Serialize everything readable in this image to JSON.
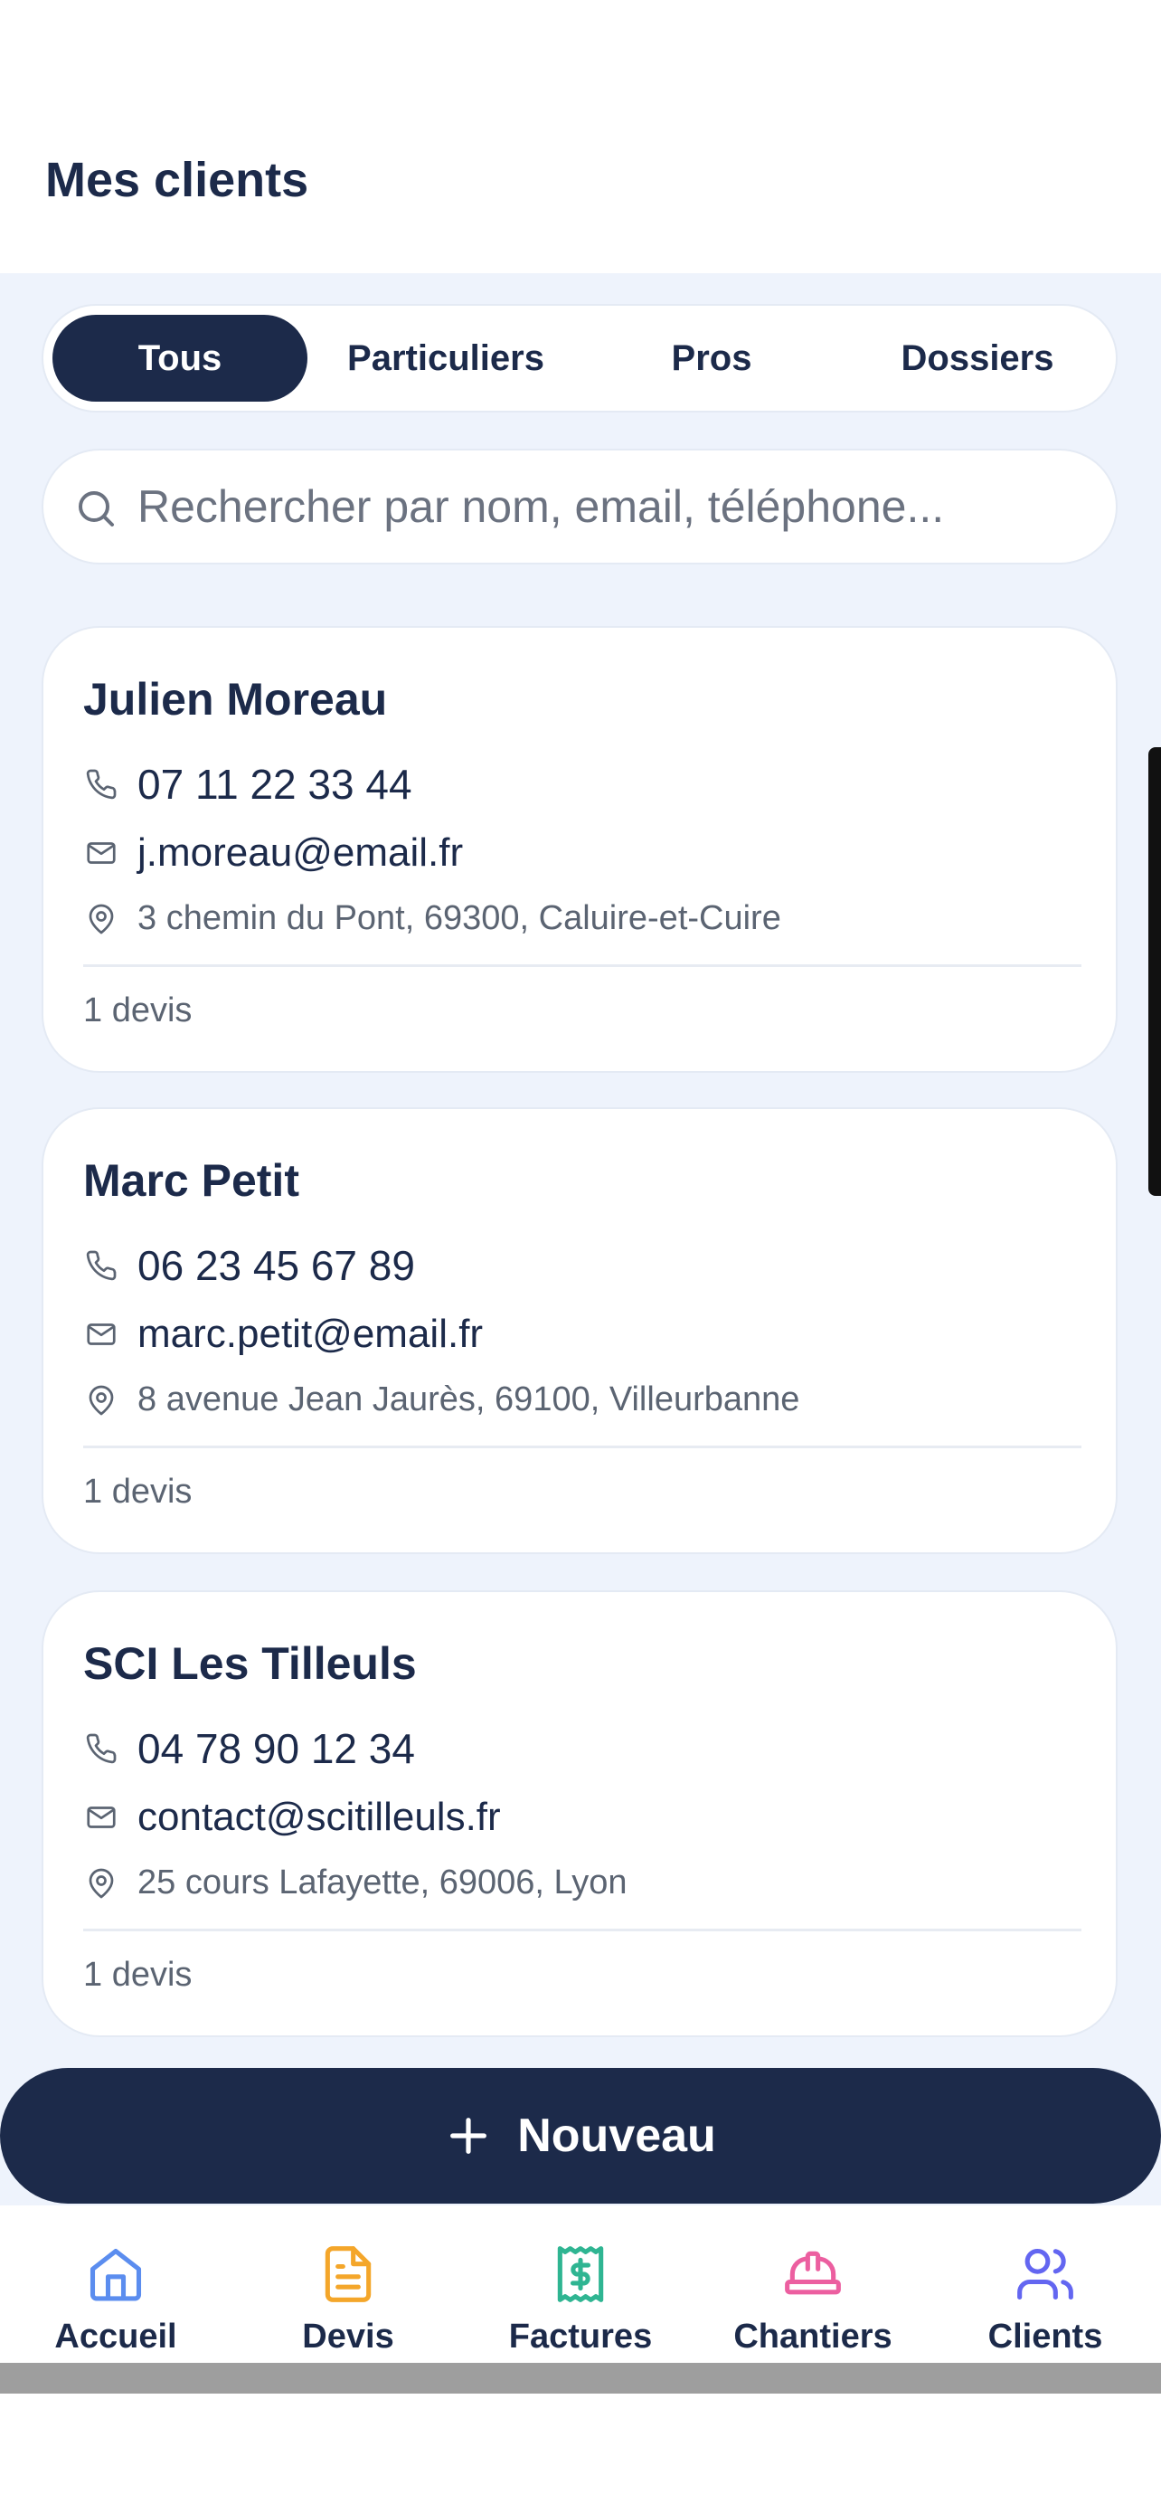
{
  "header": {
    "title": "Mes clients"
  },
  "tabs": [
    {
      "label": "Tous",
      "active": true
    },
    {
      "label": "Particuliers",
      "active": false
    },
    {
      "label": "Pros",
      "active": false
    },
    {
      "label": "Dossiers",
      "active": false
    }
  ],
  "search": {
    "placeholder": "Rechercher par nom, email, téléphone...",
    "value": "",
    "icon": "search-icon"
  },
  "clients": [
    {
      "name": "Julien Moreau",
      "phone": "07 11 22 33 44",
      "email": "j.moreau@email.fr",
      "address": "3 chemin du Pont, 69300, Caluire-et-Cuire",
      "devis": "1 devis"
    },
    {
      "name": "Marc Petit",
      "phone": "06 23 45 67 89",
      "email": "marc.petit@email.fr",
      "address": "8 avenue Jean Jaurès, 69100, Villeurbanne",
      "devis": "1 devis"
    },
    {
      "name": "SCI Les Tilleuls",
      "phone": "04 78 90 12 34",
      "email": "contact@scitilleuls.fr",
      "address": "25 cours Lafayette, 69006, Lyon",
      "devis": "1 devis"
    }
  ],
  "fab": {
    "label": "Nouveau",
    "icon": "plus-icon"
  },
  "nav": [
    {
      "label": "Accueil",
      "icon": "home-icon",
      "color": "#5b8def"
    },
    {
      "label": "Devis",
      "icon": "document-icon",
      "color": "#f4a62a"
    },
    {
      "label": "Factures",
      "icon": "receipt-icon",
      "color": "#2fb592"
    },
    {
      "label": "Chantiers",
      "icon": "hardhat-icon",
      "color": "#ec5fa0"
    },
    {
      "label": "Clients",
      "icon": "users-icon",
      "color": "#6366f1"
    }
  ],
  "colors": {
    "primary": "#1c2a4a",
    "background": "#eef3fc",
    "card": "#ffffff",
    "muted": "#5b6472"
  }
}
